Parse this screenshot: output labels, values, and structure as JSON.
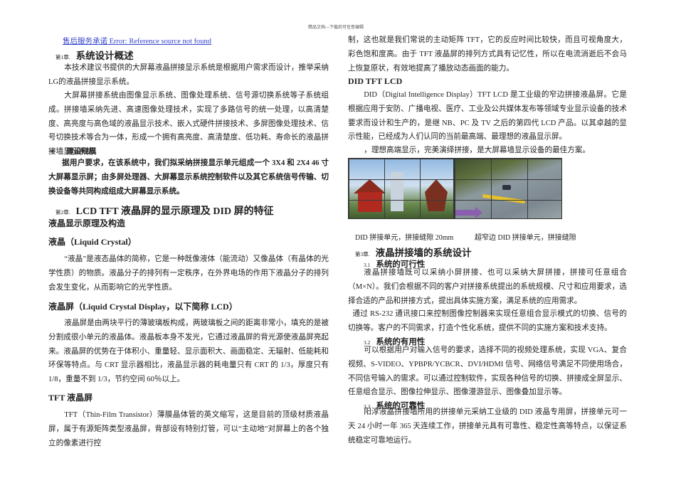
{
  "page_header": "精品文档---下载后可任意编辑",
  "toc_link": "售后服务承诺 Error: Reference source not found",
  "chapter1": {
    "num": "第1章.",
    "title": "系统设计概述",
    "p1": "本技术建议书提供的大屏幕液晶拼接显示系统是根据用户需求而设计，推举采纳LG的液晶拼接显示系统。",
    "p2": "大屏幕拼接系统由图像显示系统、图像处理系统、信号源切换系统等子系统组成。拼接墙采纳先进、高速图像处理技术，实现了多路信号的统一处理，以高清楚度、高亮度与高色域的液晶显示技术、嵌入式硬件拼接技术、多屏图像处理技术、信号切换技术等合为一体，形成一个拥有高亮度、高清楚度、低功耗、寿命长的液晶拼接墙显示系统。",
    "bullet_mark": "∗",
    "bullet_title": "建设规模",
    "p3": "据用户要求，在该系统中，我们拟采纳拼接显示单元组成一个 3X4 和 2X4 46 寸大屏幕显示屏；由多屏处理器、大屏幕显示系统控制软件以及其它系统信号传输、切换设备等共同构成组成大屏幕显示系统。"
  },
  "chapter2": {
    "num": "第2章.",
    "title": "LCD TFT 液晶屏的显示原理及 DID 屏的特征",
    "section": "液晶显示原理及构造",
    "h_lc": "液晶（Liquid Crystal）",
    "p_lc": "“液晶”是液态晶体的简称，它是一种既像液体（能流动）又像晶体（有晶体的光学性质）的物质。液晶分子的排列有一定秩序，在外界电场的作用下液晶分子的排列会发生变化，从而影响它的光学性质。",
    "h_lcd": "液晶屏（Liquid Crystal Display，以下简称 LCD）",
    "p_lcd": "液晶屏是由两块平行的薄玻璃板构成，两玻璃板之间的距离非常小，填充的是被分割成很小单元的液晶体。液晶板本身不发光，它通过液晶屏的背光源使液晶屏亮起来。液晶屏的优势在于体积小、重量轻、显示面积大、画面稳定、无辐射、低能耗和环保等特点。与 CRT 显示器相比，液晶显示器的耗电量只有 CRT 的 1/3，厚度只有 1/8，重量不到 1/3，节约空间 60％以上。",
    "h_tft": "TFT 液晶屏",
    "p_tft_left": "TFT（Thin-Film Transistor）薄膜晶体管的英文缩写，这是目前的顶级材质液晶屏，属于有源矩阵类型液晶屏，背部设有特别灯管，可以“主动地”对屏幕上的各个独立的像素进行控",
    "p_tft_right": "制，这也就是我们常说的主动矩阵 TFT，它的反应时间比较快，而且可视角度大，彩色饱和度高。由于 TFT 液晶屏的排列方式具有记忆性，所以在电流消逝后不会马上恢复原状，有效地提高了播放动态画面的能力。",
    "h_did": "DID TFT LCD",
    "p_did": "DID（Digital Intelligence Display）TFT LCD 是工业级的窄边拼接液晶屏。它是根据应用于安防、广播电视、医疗、工业及公共媒体发布等领域专业显示设备的技术要求而设计和生产的，是继 NB、PC 及 TV 之后的第四代 LCD 产品。以其卓越的显示性能，已经成为人们认同的当前最高端、最理想的液晶显示屏。",
    "p_did2": "，理想高端显示，完美演绎拼接，是大屏幕墙显示设备的最佳方案。",
    "caption_left": "DID 拼接单元，拼接缝隙 20mm",
    "caption_right": "超窄边 DID 拼接单元，拼接缝隙"
  },
  "chapter3": {
    "num": "第3章.",
    "title": "液晶拼接墙的系统设计",
    "s1_num": "3.1",
    "s1_title": "系统的可行性",
    "s1_p1": "液晶拼接墙既可以采纳小屏拼接、也可以采纳大屏拼接，拼接可任意组合（M×N）。我们会根据不同的客户对拼接系统提出的系统规模、尺寸和应用要求，选择合适的产品和拼接方式，提出具体实施方案，满足系统的应用需求。",
    "s1_p2": "通过 RS-232 通讯接口来控制图像控制器来实现任意组合显示模式的切换、信号的切换等。客户的不同需求，打造个性化系统，提供不同的实施方案和技术支持。",
    "s2_num": "3.2",
    "s2_title": "系统的有用性",
    "s2_p": "可以根据用户对输入信号的要求，选择不同的视频处理系统，实现 VGA、复合视频、S-VIDEO、YPBPR/YCBCR、DVI/HDMI 信号、网络信号满足不同使用场合，不同信号输入的需求。可以通过控制软件，实现各种信号的切换、拼接成全屏显示、任意组合显示、图像拉伸显示、图像漫游显示、图像叠加显示等。",
    "s3_num": "3.3",
    "s3_title": "系统的可靠性",
    "s3_p": "阳淳液晶拼接墙所用的拼接单元采纳工业级的 DID 液晶专用屏，拼接单元可一天 24 小时一年 365 天连续工作，拼接单元具有可靠性、稳定性高等特点，以保证系统稳定可靠地运行。"
  },
  "colors": {
    "link": "#3344cc",
    "arrow": "#8a5fb0"
  }
}
